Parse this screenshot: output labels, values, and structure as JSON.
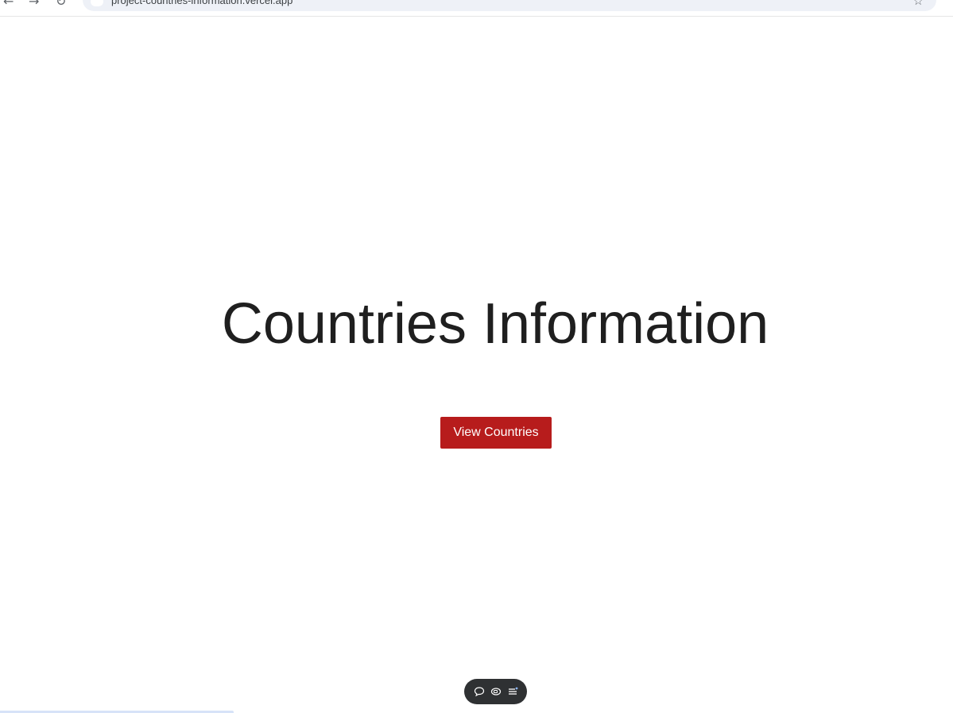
{
  "browser": {
    "url": "project-countries-information.vercel.app",
    "icons": [
      "back-arrow-icon",
      "forward-arrow-icon",
      "reload-icon",
      "site-info-icon",
      "bookmark-star-icon"
    ]
  },
  "main": {
    "title": "Countries Information",
    "cta_label": "View Countries"
  },
  "floating_toolbar": {
    "icons": [
      "comment-icon",
      "screen-icon",
      "list-icon"
    ]
  },
  "colors": {
    "cta_background": "#b71c1c",
    "title_text": "#1f1f1f",
    "toolbar_background": "#2f3133",
    "address_bar": "#eef1f7"
  }
}
